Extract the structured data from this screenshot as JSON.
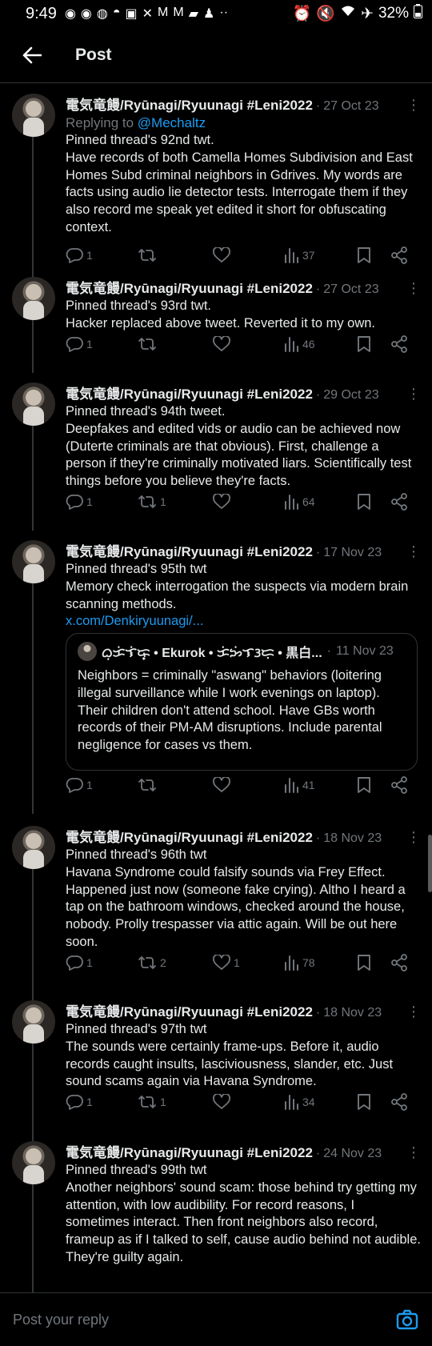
{
  "status_bar": {
    "time": "9:49",
    "battery": "32%",
    "left_icons": [
      "messenger-icon",
      "messenger-icon",
      "chat-icon",
      "cake-icon",
      "twitch-icon",
      "x-icon",
      "gmail-icon",
      "gmail-icon",
      "message-icon",
      "person-icon",
      "more-icon"
    ],
    "right_icons": [
      "alarm-icon",
      "mute-icon",
      "wifi-icon",
      "airplane-icon",
      "battery-icon"
    ]
  },
  "header": {
    "title": "Post",
    "back_icon": "arrow-left-icon"
  },
  "tweets": [
    {
      "author": "電気竜饅/Ryūnagi/Ryuunagi #Leni2022",
      "date": "27 Oct 23",
      "replying_prefix": "Replying to ",
      "replying_handle": "@Mechaltz",
      "text": "Pinned thread's 92nd twt.\nHave records of both Camella Homes Subdivision and East Homes Subd criminal neighbors in Gdrives. My words are facts using audio lie detector tests. Interrogate them if they also record me speak yet edited it short for obfuscating context.",
      "replies": "1",
      "retweets": "",
      "likes": "",
      "views": "37"
    },
    {
      "author": "電気竜饅/Ryūnagi/Ryuunagi #Leni2022",
      "date": "27 Oct 23",
      "text": "Pinned thread's 93rd twt.\nHacker replaced above tweet. Reverted it to my own.",
      "replies": "1",
      "retweets": "",
      "likes": "",
      "views": "46"
    },
    {
      "author": "電気竜饅/Ryūnagi/Ryuunagi #Leni2022",
      "date": "29 Oct 23",
      "text": "Pinned thread's 94th tweet.\nDeepfakes and edited vids or audio can be achieved now (Duterte criminals are that obvious). First, challenge a person if they're criminally motivated liars. Scientifically test things before you believe they're facts.",
      "replies": "1",
      "retweets": "1",
      "likes": "",
      "views": "64"
    },
    {
      "author": "電気竜饅/Ryūnagi/Ryuunagi #Leni2022",
      "date": "17 Nov 23",
      "text": "Pinned thread's 95th twt\nMemory check interrogation the suspects via modern brain scanning methods.",
      "link": "x.com/Denkiryuunagi/...",
      "quote": {
        "name": "ᜊᜓᜃᜒᜎᜒᜍ᜔ • Ekurok • ᜃᜒᜅᜒᜎᜂᜇᜓ • 黒白...",
        "date": "11 Nov 23",
        "text": "Neighbors = criminally \"aswang\" behaviors (loitering illegal surveillance while I work evenings on laptop). Their children don't attend school. Have GBs worth records of their PM-AM disruptions. Include parental negligence for cases vs them."
      },
      "replies": "1",
      "retweets": "",
      "likes": "",
      "views": "41"
    },
    {
      "author": "電気竜饅/Ryūnagi/Ryuunagi #Leni2022",
      "date": "18 Nov 23",
      "text": "Pinned thread's 96th twt\nHavana Syndrome could falsify sounds via Frey Effect. Happened just now (someone fake crying). Altho I heard a tap on the bathroom windows, checked around the house, nobody. Prolly trespasser via attic again. Will be out here soon.",
      "replies": "1",
      "retweets": "2",
      "likes": "1",
      "views": "78"
    },
    {
      "author": "電気竜饅/Ryūnagi/Ryuunagi #Leni2022",
      "date": "18 Nov 23",
      "text": "Pinned thread's 97th twt\nThe sounds were certainly frame-ups. Before it, audio records caught insults, lasciviousness, slander, etc. Just sound scams again via Havana Syndrome.",
      "replies": "1",
      "retweets": "1",
      "likes": "",
      "views": "34"
    },
    {
      "author": "電気竜饅/Ryūnagi/Ryuunagi #Leni2022",
      "date": "24 Nov 23",
      "text": "Pinned thread's 99th twt\nAnother neighbors' sound scam: those behind try getting my attention, with low audibility. For record reasons, I sometimes interact. Then front neighbors also record, frameup as if I talked to self, cause audio behind not audible. They're guilty again."
    }
  ],
  "separator": "·",
  "more_label": "⋮",
  "reply_bar": {
    "placeholder": "Post your reply",
    "camera_icon": "camera-icon"
  },
  "colors": {
    "background": "#000000",
    "text": "#e7e9ea",
    "secondary": "#71767b",
    "accent": "#1d9bf0",
    "divider": "#2f3336"
  }
}
